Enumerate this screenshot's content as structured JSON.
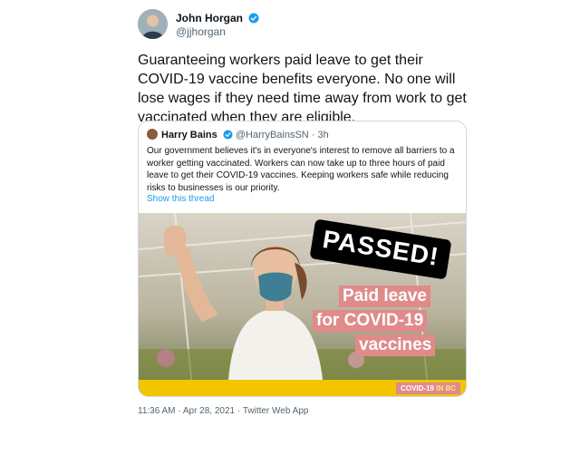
{
  "author": {
    "name": "John Horgan",
    "handle": "@jjhorgan",
    "verified_icon": "verified-badge-icon",
    "verified_color": "#1d9bf0"
  },
  "tweet": {
    "text": "Guaranteeing workers paid leave to get their COVID-19 vaccine benefits everyone. No one will lose wages if they need time away from work to get vaccinated when they are eligible."
  },
  "quote": {
    "name": "Harry Bains",
    "handle": "@HarryBainsSN",
    "separator": "·",
    "time": "3h",
    "text": "Our government believes it's in everyone's interest to remove all barriers to a worker getting vaccinated. Workers can now take up to three hours of paid leave to get their COVID-19 vaccines. Keeping workers safe while reducing risks to businesses is our priority.",
    "show_thread": "Show this thread",
    "link_color": "#1d9bf0"
  },
  "media": {
    "passed": "PASSED!",
    "caption_lines": [
      "Paid leave",
      "for COVID-19",
      "vaccines"
    ],
    "tag_prefix": "COVID-19",
    "tag_suffix": "IN BC",
    "accent_color": "#e08a8a",
    "bar_color": "#f2c500"
  },
  "meta": {
    "timestamp": "11:36 AM · Apr 28, 2021 · Twitter Web App"
  }
}
